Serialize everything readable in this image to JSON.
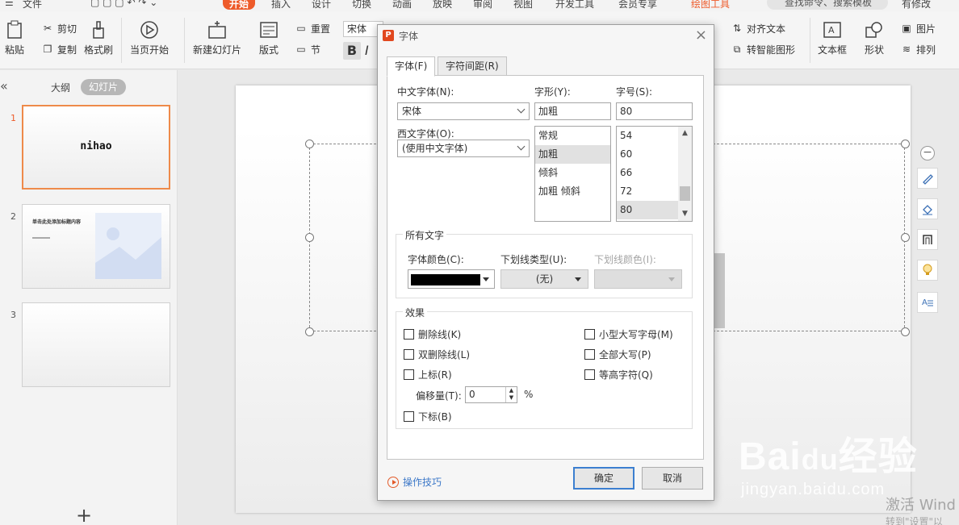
{
  "menubar": {
    "items": [
      {
        "label": "文件"
      },
      {
        "label": "开始"
      },
      {
        "label": "插入"
      },
      {
        "label": "设计"
      },
      {
        "label": "切换"
      },
      {
        "label": "动画"
      },
      {
        "label": "放映"
      },
      {
        "label": "审阅"
      },
      {
        "label": "视图"
      },
      {
        "label": "开发工具"
      },
      {
        "label": "会员专享"
      },
      {
        "label": "绘图工具"
      }
    ],
    "search_placeholder": "查找命令、搜索模板",
    "status": "有修改"
  },
  "ribbon": {
    "paste": "粘贴",
    "cut": "剪切",
    "copy": "复制",
    "format_painter": "格式刷",
    "start_from_current": "当页开始",
    "new_slide": "新建幻灯片",
    "layout": "版式",
    "reset": "重置",
    "section": "节",
    "font_name": "宋体",
    "bold": "B",
    "italic": "I",
    "align_text": "对齐文本",
    "smart_shape": "转智能图形",
    "textbox": "文本框",
    "shape": "形状",
    "picture": "图片",
    "arrange": "排列"
  },
  "left_panel": {
    "tab_outline": "大纲",
    "tab_slides": "幻灯片",
    "thumbs": [
      {
        "num": "1",
        "text": "nihao"
      },
      {
        "num": "2",
        "text": "单击此处添加标题内容"
      },
      {
        "num": "3",
        "text": ""
      }
    ],
    "add": "+"
  },
  "dialog": {
    "title": "字体",
    "tabs": [
      {
        "label": "字体(F)"
      },
      {
        "label": "字符间距(R)"
      }
    ],
    "chinese_font_label": "中文字体(N):",
    "chinese_font_value": "宋体",
    "western_font_label": "西文字体(O):",
    "western_font_value": "(使用中文字体)",
    "style_label": "字形(Y):",
    "style_value": "加粗",
    "style_options": [
      "常规",
      "加粗",
      "倾斜",
      "加粗 倾斜"
    ],
    "size_label": "字号(S):",
    "size_value": "80",
    "size_options": [
      "54",
      "60",
      "66",
      "72",
      "80"
    ],
    "all_text_group": "所有文字",
    "font_color_label": "字体颜色(C):",
    "font_color": "#000000",
    "underline_type_label": "下划线类型(U):",
    "underline_type_value": "(无)",
    "underline_color_label": "下划线颜色(I):",
    "effects_group": "效果",
    "effects": {
      "strikethrough": "删除线(K)",
      "double_strikethrough": "双删除线(L)",
      "superscript": "上标(R)",
      "offset_label": "偏移量(T):",
      "offset_value": "0",
      "percent": "%",
      "subscript": "下标(B)",
      "small_caps": "小型大写字母(M)",
      "all_caps": "全部大写(P)",
      "equalize_height": "等高字符(Q)"
    },
    "tips": "操作技巧",
    "ok": "确定",
    "cancel": "取消"
  },
  "watermark": {
    "logo": "Bai du 经验",
    "url": "jingyan.baidu.com",
    "activate_1": "激活 Wind",
    "activate_2": "转到\"设置\"以"
  },
  "colors": {
    "accent": "#ee5b2a",
    "dialog_primary_border": "#3c7fd0",
    "link": "#3c78c8"
  }
}
